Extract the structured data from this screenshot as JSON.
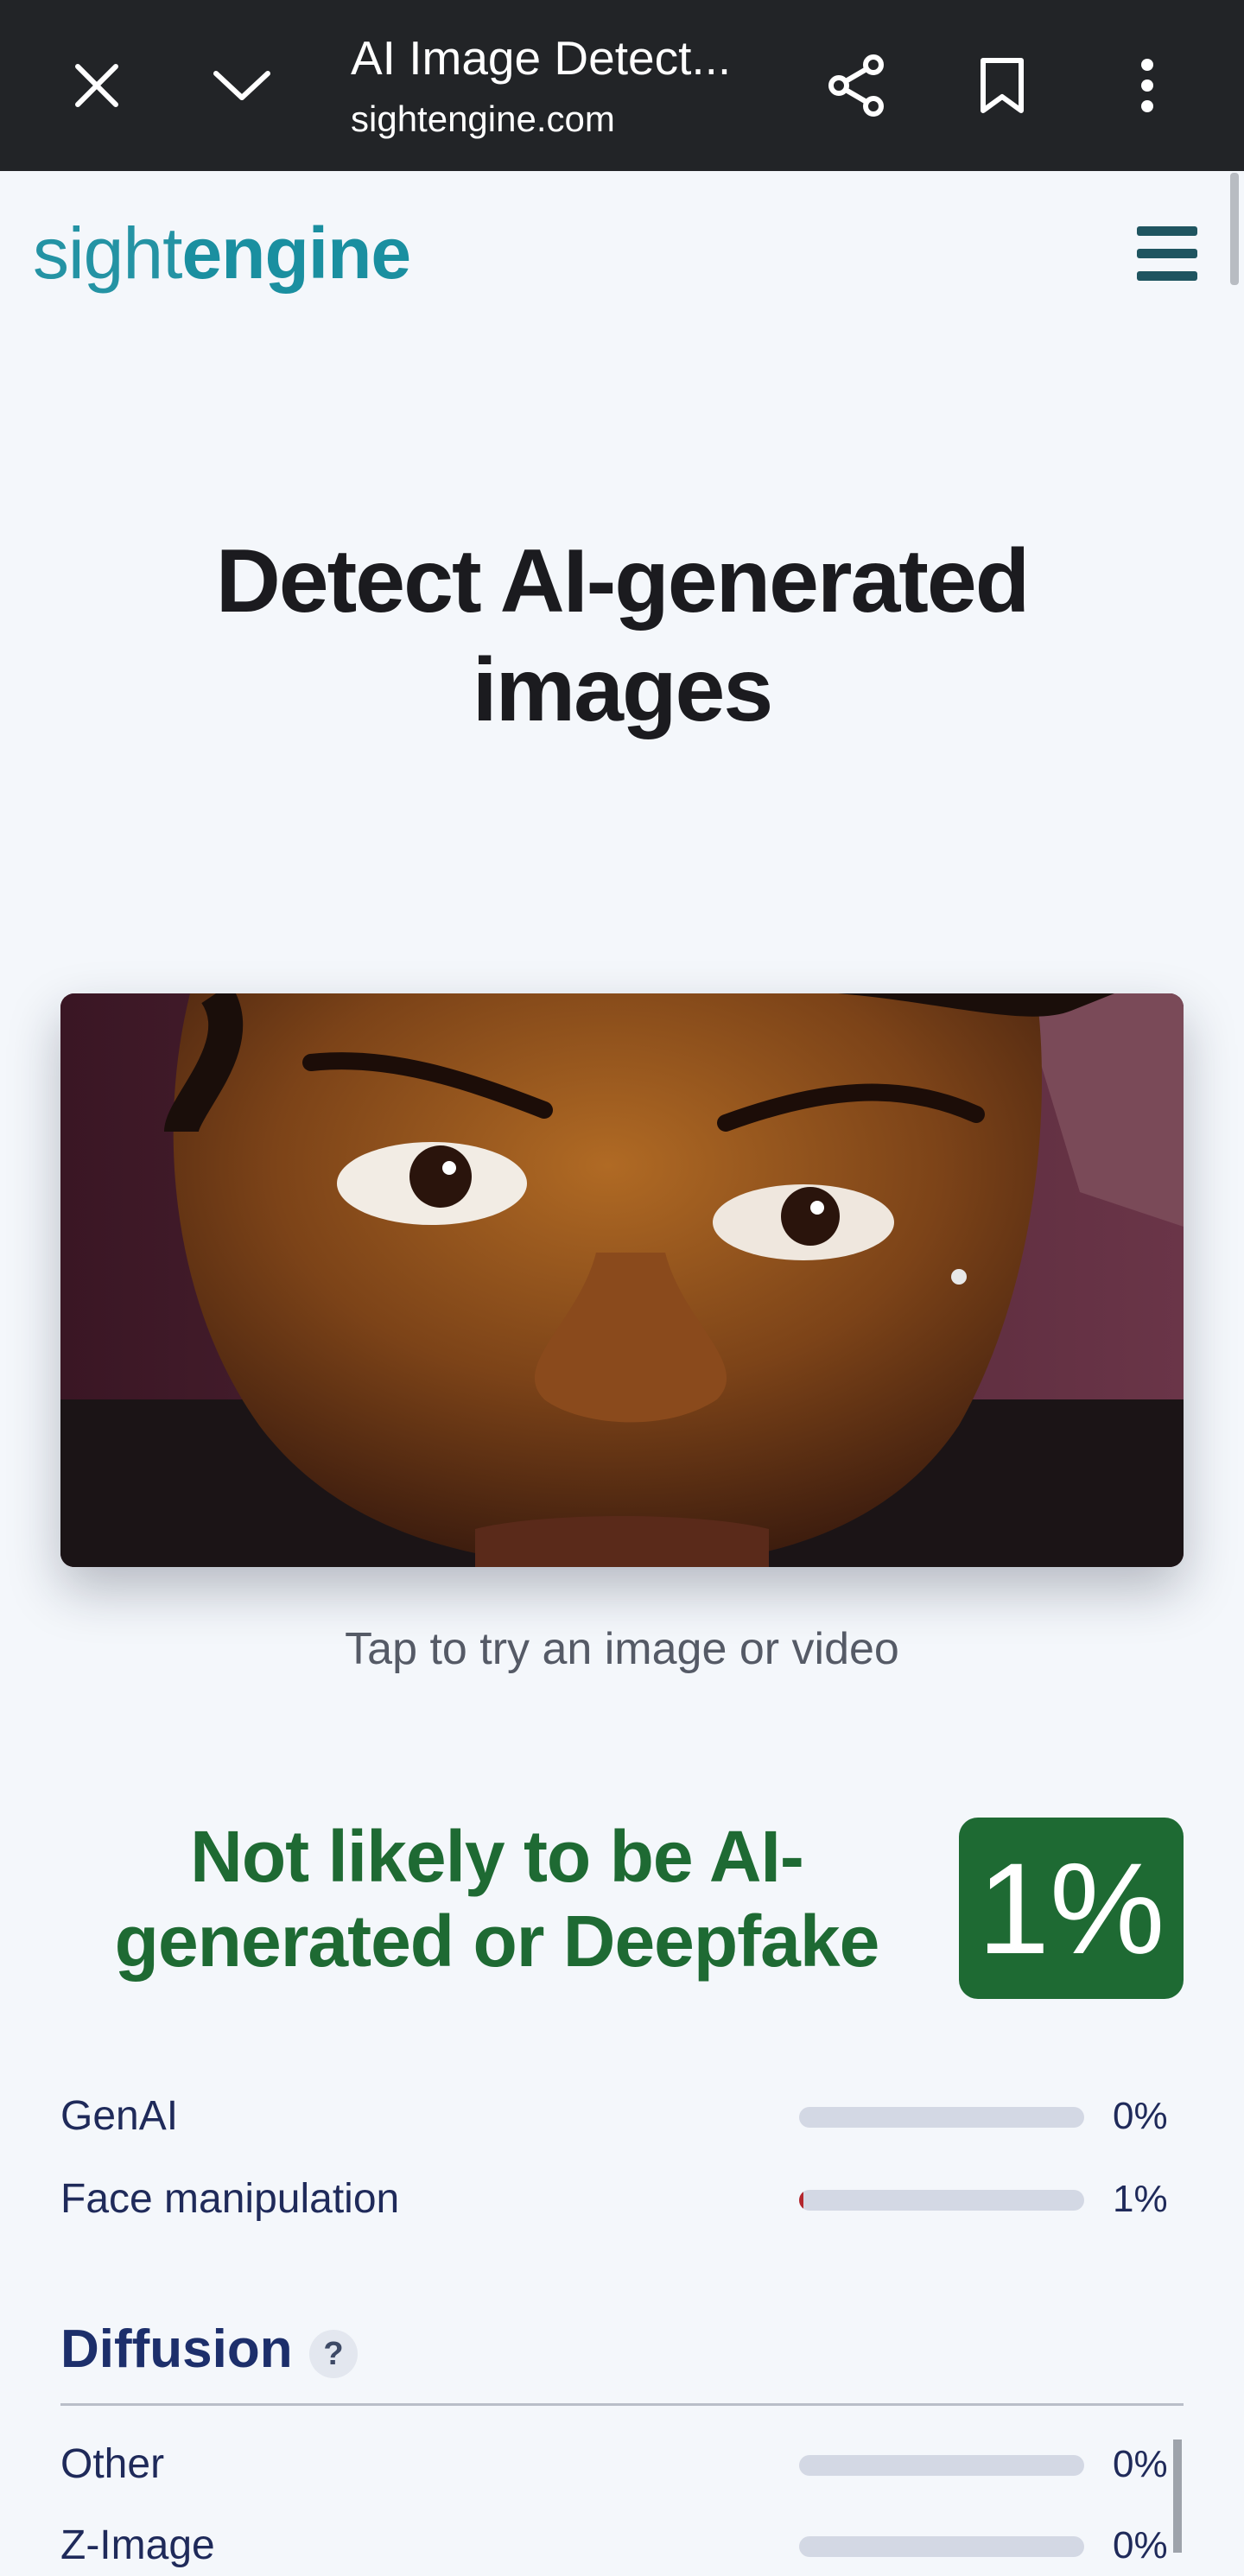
{
  "browser": {
    "title": "AI Image Detect...",
    "url": "sightengine.com",
    "icons": [
      "close-icon",
      "chevron-down-icon",
      "share-icon",
      "bookmark-icon",
      "more-vert-icon"
    ]
  },
  "site": {
    "logo_light": "sight",
    "logo_bold": "engine",
    "menu_icon": "hamburger-menu-icon"
  },
  "hero": {
    "headline": "Detect AI-generated images",
    "tap_caption": "Tap to try an image or video"
  },
  "result": {
    "verdict": "Not likely to be AI-generated or Deepfake",
    "score": "1%",
    "colors": {
      "verdict": "#1e6a33",
      "bar_fill": "#b3262d",
      "bar_track": "#d3d8e4"
    }
  },
  "metrics": [
    {
      "label": "GenAI",
      "value": "0%",
      "level": 0
    },
    {
      "label": "Face manipulation",
      "value": "1%",
      "level": 1
    }
  ],
  "diffusion": {
    "title": "Diffusion",
    "help": "?",
    "rows": [
      {
        "label": "Other",
        "value": "0%",
        "level": 0
      },
      {
        "label": "Z-Image",
        "value": "0%",
        "level": 0
      }
    ]
  }
}
